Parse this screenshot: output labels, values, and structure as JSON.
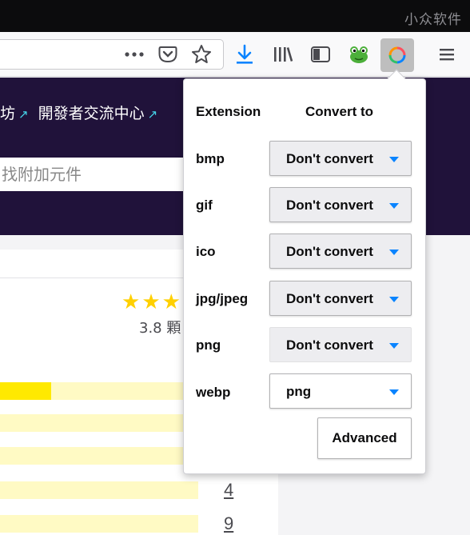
{
  "watermark": "小众软件",
  "toolbar": {
    "icons": [
      "more-icon",
      "pocket-icon",
      "bookmark-star-icon",
      "download-icon",
      "library-icon",
      "sidebar-icon",
      "frog-extension-icon",
      "convert-extension-icon",
      "menu-icon"
    ],
    "accent": "#0a84ff"
  },
  "site": {
    "links": [
      {
        "label": "坊",
        "icon": "external-link-icon"
      },
      {
        "label": "開發者交流中心",
        "icon": "external-link-icon"
      }
    ],
    "search_placeholder": "找附加元件",
    "header_color": "#20123a"
  },
  "rating": {
    "stars_shown": 3,
    "text": "3.8 顆",
    "bar_fill_fraction_first": 0.26,
    "counts": [
      "4",
      "9"
    ]
  },
  "popup": {
    "header_extension": "Extension",
    "header_convert": "Convert to",
    "rows": [
      {
        "ext": "bmp",
        "value": "Don't convert"
      },
      {
        "ext": "gif",
        "value": "Don't convert"
      },
      {
        "ext": "ico",
        "value": "Don't convert"
      },
      {
        "ext": "jpg/jpeg",
        "value": "Don't convert"
      },
      {
        "ext": "png",
        "value": "Don't convert"
      },
      {
        "ext": "webp",
        "value": "png"
      }
    ],
    "advanced_label": "Advanced"
  }
}
